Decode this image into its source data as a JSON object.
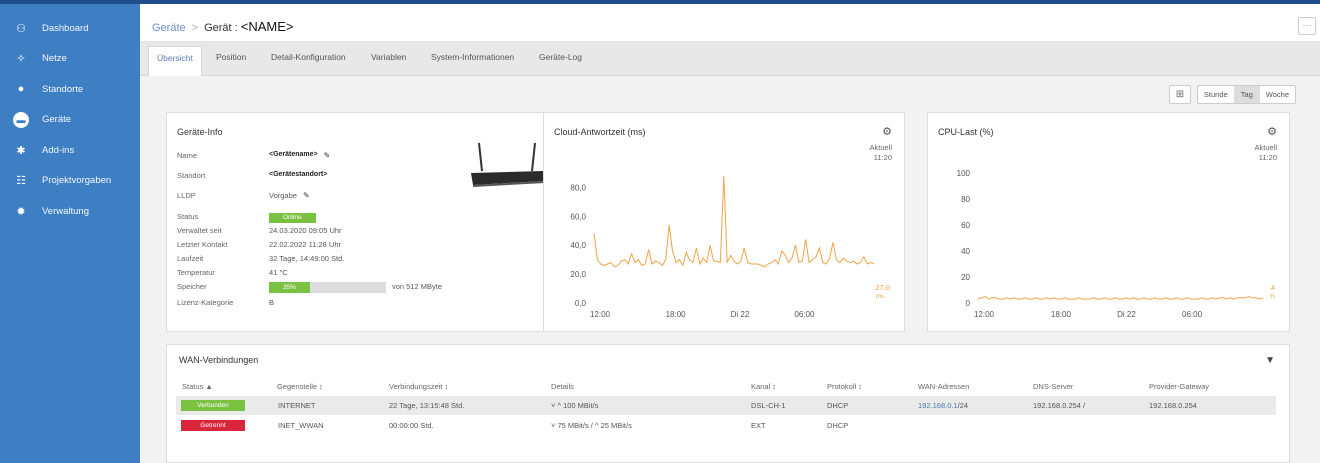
{
  "sidebar": {
    "items": [
      {
        "label": "Dashboard",
        "icon": "dashboard-icon",
        "glyph": "⚇",
        "active": false
      },
      {
        "label": "Netze",
        "icon": "network-icon",
        "glyph": "✧",
        "active": false
      },
      {
        "label": "Standorte",
        "icon": "location-pin-icon",
        "glyph": "●",
        "active": false
      },
      {
        "label": "Geräte",
        "icon": "device-icon",
        "glyph": "▬",
        "active": true
      },
      {
        "label": "Add-ins",
        "icon": "puzzle-icon",
        "glyph": "✱",
        "active": false
      },
      {
        "label": "Projektvorgaben",
        "icon": "sliders-icon",
        "glyph": "☷",
        "active": false
      },
      {
        "label": "Verwaltung",
        "icon": "gear-icon",
        "glyph": "✹",
        "active": false
      }
    ]
  },
  "header": {
    "crumb": "Geräte",
    "sep": ">",
    "title": "Gerät :",
    "name": "<NAME>",
    "more": "···"
  },
  "tabs": [
    "Übersicht",
    "Position",
    "Detail-Konfiguration",
    "Variablen",
    "System-Informationen",
    "Geräte-Log"
  ],
  "toolbar": {
    "icon": "dashboard-layout-icon",
    "ranges": [
      "Stunde",
      "Tag",
      "Woche"
    ],
    "selected": "Tag"
  },
  "device_info": {
    "title": "Geräte-Info",
    "rows": [
      {
        "key": "Name",
        "value": "<Gerätename>"
      },
      {
        "key": "Standort",
        "value": "<Gerätestandort>"
      },
      {
        "key": "LLDP",
        "value": "Vorgabe"
      },
      {
        "key": "Status",
        "value": "Online"
      },
      {
        "key": "Verwaltet seit",
        "value": "24.03.2020 09:05 Uhr"
      },
      {
        "key": "Letzter Kontakt",
        "value": "22.02.2022 11:28 Uhr"
      },
      {
        "key": "Laufzeit",
        "value": "32 Tage, 14:49:00 Std."
      },
      {
        "key": "Temperatur",
        "value": "41 °C"
      },
      {
        "key": "Speicher",
        "value": "35%"
      },
      {
        "key": "Lizenz-Kategorie",
        "value": "B"
      }
    ],
    "memory_fraction": 0.35,
    "memory_total": "von 512 MByte"
  },
  "cloud_chart": {
    "title": "Cloud-Antwortzeit (ms)",
    "aktuell": "Aktuell",
    "time": "11:20",
    "current_value": "27,0",
    "unit": "ms"
  },
  "cpu_chart": {
    "title": "CPU-Last (%)",
    "aktuell": "Aktuell",
    "time": "11:20",
    "current_value": "4",
    "unit": "%"
  },
  "chart_data": [
    {
      "type": "line",
      "title": "Cloud-Antwortzeit (ms)",
      "ylabel": "",
      "ylim": [
        0,
        90
      ],
      "yticks": [
        "0,0",
        "20,0",
        "40,0",
        "60,0",
        "80,0"
      ],
      "xticks": [
        "12:00",
        "18:00",
        "Di 22",
        "06:00"
      ],
      "series": [
        {
          "values": [
            48,
            30,
            27,
            26,
            27,
            28,
            25,
            26,
            29,
            30,
            27,
            34,
            28,
            30,
            26,
            27,
            37,
            27,
            29,
            28,
            26,
            30,
            54,
            36,
            28,
            30,
            26,
            35,
            30,
            28,
            38,
            27,
            31,
            28,
            40,
            29,
            29,
            28,
            88,
            28,
            33,
            29,
            27,
            29,
            38,
            28,
            27,
            27,
            27,
            26,
            25,
            27,
            28,
            30,
            27,
            36,
            33,
            28,
            31,
            40,
            28,
            29,
            44,
            28,
            30,
            32,
            38,
            28,
            27,
            31,
            42,
            30,
            28,
            31,
            29,
            28,
            29,
            27,
            28,
            32,
            27,
            28,
            27
          ]
        }
      ],
      "color": "#f0a346"
    },
    {
      "type": "line",
      "title": "CPU-Last (%)",
      "ylabel": "",
      "ylim": [
        0,
        100
      ],
      "yticks": [
        "0",
        "20",
        "40",
        "60",
        "80",
        "100"
      ],
      "xticks": [
        "12:00",
        "18:00",
        "Di 22",
        "06:00"
      ],
      "series": [
        {
          "values": [
            3,
            4,
            5,
            3,
            4,
            4,
            3,
            3,
            4,
            3,
            4,
            3,
            3,
            4,
            3,
            3,
            4,
            3,
            3,
            4,
            3,
            4,
            3,
            3,
            4,
            3,
            3,
            3,
            4,
            3,
            3,
            3,
            4,
            3,
            3,
            4,
            3,
            3,
            4,
            3,
            3,
            4,
            3,
            4,
            3,
            3,
            4,
            3,
            3,
            4,
            3,
            3,
            4,
            3,
            3,
            4,
            3,
            3,
            4,
            3,
            3,
            3,
            4,
            3,
            3,
            4,
            3,
            4,
            4,
            3,
            4,
            3,
            4,
            4,
            4,
            5,
            4,
            4,
            3,
            4
          ]
        }
      ],
      "color": "#f0a346"
    }
  ],
  "wan": {
    "title": "WAN-Verbindungen",
    "columns": [
      "Status ▲",
      "Gegenstelle ↕",
      "Verbindungszeit ↕",
      "Details",
      "Kanal ↕",
      "Protokoll ↕",
      "WAN-Adressen",
      "DNS-Server",
      "Provider-Gateway"
    ],
    "rows": [
      {
        "status": "Verbunden",
        "status_color": "#7bc142",
        "gegenstelle": "INTERNET",
        "zeit": "22 Tage, 13:15:48 Std.",
        "details": "˅ ^ 100 MBit/s",
        "kanal": "DSL-CH-1",
        "protokoll": "DHCP",
        "wan_link": "192.168.0.1",
        "wan_suffix": "/24",
        "dns": "192.168.0.254 /",
        "gateway": "192.168.0.254"
      },
      {
        "status": "Getrennt",
        "status_color": "#d9263a",
        "gegenstelle": "INET_WWAN",
        "zeit": "00:00:00 Std.",
        "details": "˅ 75 MBit/s / ^ 25 MBit/s",
        "kanal": "EXT",
        "protokoll": "DHCP",
        "wan_link": "",
        "wan_suffix": "",
        "dns": "",
        "gateway": ""
      }
    ]
  }
}
